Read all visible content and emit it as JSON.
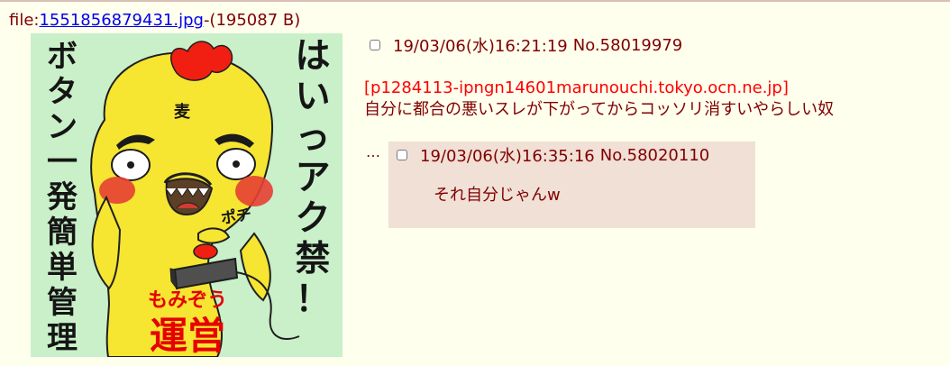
{
  "file": {
    "prefix": "file:",
    "name": "1551856879431.jpg",
    "size": "-(195087 B)"
  },
  "thumbnail": {
    "right_text": [
      "は",
      "い",
      "っ",
      "ア",
      "ク",
      "禁",
      "！"
    ],
    "left_text": [
      "ボ",
      "タ",
      "ン",
      "一",
      "発",
      "簡",
      "単",
      "管",
      "理"
    ],
    "badge_small": "もみぞう",
    "badge_large": "運営",
    "head_mark": "麦",
    "scribble": "ポチ",
    "colors": {
      "background": "#c9f0c9",
      "bird": "#f6e531",
      "title": "#151515",
      "badge": "#e60000"
    }
  },
  "post": {
    "datetime": "19/03/06(水)16:21:19",
    "number": "No.58019979",
    "ip": "[p1284113-ipngn14601marunouchi.tokyo.ocn.ne.jp]",
    "body": "自分に都合の悪いスレが下がってからコッソリ消すいやらしい奴"
  },
  "reply": {
    "ellipsis": "…",
    "datetime": "19/03/06(水)16:35:16",
    "number": "No.58020110",
    "body": "それ自分じゃんw"
  }
}
